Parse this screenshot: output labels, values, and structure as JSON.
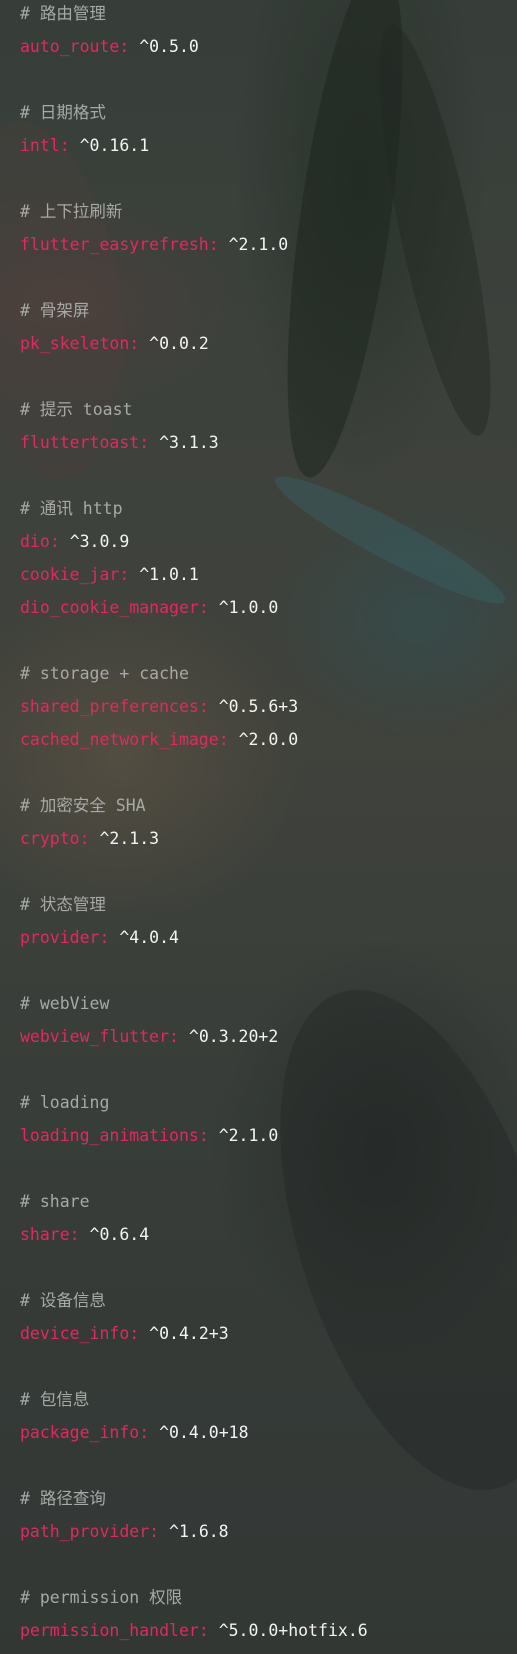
{
  "sections": [
    {
      "comment": "# 路由管理",
      "deps": [
        {
          "name": "auto_route",
          "version": "^0.5.0"
        }
      ]
    },
    {
      "comment": "# 日期格式",
      "deps": [
        {
          "name": "intl",
          "version": "^0.16.1"
        }
      ]
    },
    {
      "comment": "# 上下拉刷新",
      "deps": [
        {
          "name": "flutter_easyrefresh",
          "version": "^2.1.0"
        }
      ]
    },
    {
      "comment": "# 骨架屏",
      "deps": [
        {
          "name": "pk_skeleton",
          "version": "^0.0.2"
        }
      ]
    },
    {
      "comment": "# 提示 toast",
      "deps": [
        {
          "name": "fluttertoast",
          "version": "^3.1.3"
        }
      ]
    },
    {
      "comment": "# 通讯 http",
      "deps": [
        {
          "name": "dio",
          "version": "^3.0.9"
        },
        {
          "name": "cookie_jar",
          "version": "^1.0.1"
        },
        {
          "name": "dio_cookie_manager",
          "version": "^1.0.0"
        }
      ]
    },
    {
      "comment": "# storage + cache",
      "deps": [
        {
          "name": "shared_preferences",
          "version": "^0.5.6+3"
        },
        {
          "name": "cached_network_image",
          "version": "^2.0.0"
        }
      ]
    },
    {
      "comment": "# 加密安全 SHA",
      "deps": [
        {
          "name": "crypto",
          "version": "^2.1.3"
        }
      ]
    },
    {
      "comment": "# 状态管理",
      "deps": [
        {
          "name": "provider",
          "version": "^4.0.4"
        }
      ]
    },
    {
      "comment": "# webView",
      "deps": [
        {
          "name": "webview_flutter",
          "version": "^0.3.20+2"
        }
      ]
    },
    {
      "comment": "# loading",
      "deps": [
        {
          "name": "loading_animations",
          "version": "^2.1.0"
        }
      ]
    },
    {
      "comment": "# share",
      "deps": [
        {
          "name": "share",
          "version": "^0.6.4"
        }
      ]
    },
    {
      "comment": "# 设备信息",
      "deps": [
        {
          "name": "device_info",
          "version": "^0.4.2+3"
        }
      ]
    },
    {
      "comment": "# 包信息",
      "deps": [
        {
          "name": "package_info",
          "version": "^0.4.0+18"
        }
      ]
    },
    {
      "comment": "# 路径查询",
      "deps": [
        {
          "name": "path_provider",
          "version": "^1.6.8"
        }
      ]
    },
    {
      "comment": "# permission 权限",
      "deps": [
        {
          "name": "permission_handler",
          "version": "^5.0.0+hotfix.6"
        }
      ]
    }
  ],
  "colors": {
    "comment": "#a7a9a6",
    "key": "#e2295f",
    "value": "#f3f3f3"
  }
}
